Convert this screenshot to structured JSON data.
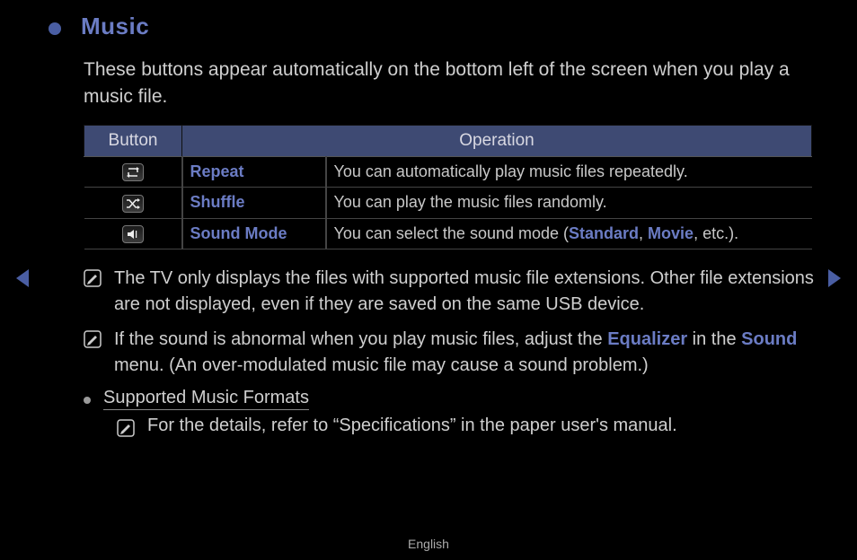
{
  "title": "Music",
  "intro": "These buttons appear automatically on the bottom left of the screen when you play a music file.",
  "table": {
    "headers": {
      "button": "Button",
      "operation": "Operation"
    },
    "rows": [
      {
        "name": "Repeat",
        "desc": "You can automatically play music files repeatedly."
      },
      {
        "name": "Shuffle",
        "desc": "You can play the music files randomly."
      },
      {
        "name": "Sound Mode",
        "desc_pre": "You can select the sound mode (",
        "hl1": "Standard",
        "sep": ", ",
        "hl2": "Movie",
        "desc_post": ", etc.)."
      }
    ]
  },
  "note1": "The TV only displays the files with supported music file extensions. Other file extensions are not displayed, even if they are saved on the same USB device.",
  "note2": {
    "p1": "If the sound is abnormal when you play music files, adjust the ",
    "hl1": "Equalizer",
    "p2": " in the ",
    "hl2": "Sound",
    "p3": " menu. (An over-modulated music file may cause a sound problem.)"
  },
  "formats": {
    "title": "Supported Music Formats",
    "note": "For the details, refer to “Specifications” in the paper user's manual."
  },
  "footer_lang": "English"
}
